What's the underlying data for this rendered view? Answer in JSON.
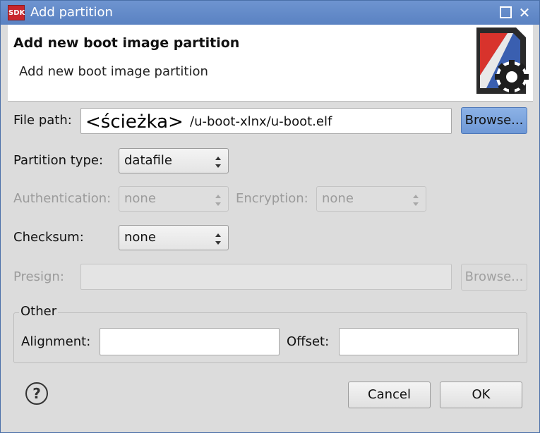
{
  "window": {
    "app_icon_text": "SDK",
    "title": "Add partition",
    "maximize_glyph": "",
    "close_glyph": "✕"
  },
  "banner": {
    "title": "Add new boot image partition",
    "subtitle": "Add new boot image partition"
  },
  "file_path": {
    "label": "File path:",
    "overlay": "<ścieżka>",
    "value": "/u-boot-xlnx/u-boot.elf",
    "browse": "Browse..."
  },
  "partition_type": {
    "label": "Partition type:",
    "value": "datafile"
  },
  "authentication": {
    "label": "Authentication:",
    "value": "none"
  },
  "encryption": {
    "label": "Encryption:",
    "value": "none"
  },
  "checksum": {
    "label": "Checksum:",
    "value": "none"
  },
  "presign": {
    "label": "Presign:",
    "value": "",
    "browse": "Browse..."
  },
  "other": {
    "title": "Other",
    "alignment_label": "Alignment:",
    "alignment_value": "",
    "offset_label": "Offset:",
    "offset_value": ""
  },
  "footer": {
    "help": "?",
    "cancel": "Cancel",
    "ok": "OK"
  },
  "colors": {
    "accent": "#6e98d6",
    "titlebar": "#5e86c4"
  }
}
